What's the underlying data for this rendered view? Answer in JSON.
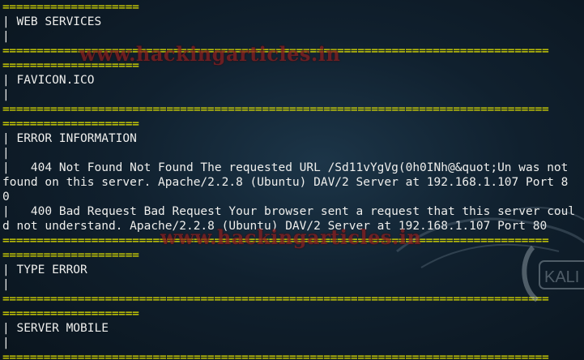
{
  "terminal": {
    "lines": [
      {
        "kind": "sep",
        "text": "===================="
      },
      {
        "kind": "text",
        "text": "| WEB SERVICES"
      },
      {
        "kind": "text",
        "text": "|"
      },
      {
        "kind": "sep",
        "text": "================================================================================"
      },
      {
        "kind": "sep",
        "text": "===================="
      },
      {
        "kind": "text",
        "text": "| FAVICON.ICO"
      },
      {
        "kind": "text",
        "text": "|"
      },
      {
        "kind": "sep",
        "text": "================================================================================"
      },
      {
        "kind": "sep",
        "text": "===================="
      },
      {
        "kind": "text",
        "text": "| ERROR INFORMATION"
      },
      {
        "kind": "text",
        "text": "|"
      },
      {
        "kind": "text",
        "text": "|   404 Not Found Not Found The requested URL /Sd11vYgVg(0h0INh@&quot;Un was not"
      },
      {
        "kind": "text",
        "text": "found on this server. Apache/2.2.8 (Ubuntu) DAV/2 Server at 192.168.1.107 Port 8"
      },
      {
        "kind": "text",
        "text": "0"
      },
      {
        "kind": "text",
        "text": "|   400 Bad Request Bad Request Your browser sent a request that this server coul"
      },
      {
        "kind": "text",
        "text": "d not understand. Apache/2.2.8 (Ubuntu) DAV/2 Server at 192.168.1.107 Port 80"
      },
      {
        "kind": "sep",
        "text": "================================================================================"
      },
      {
        "kind": "sep",
        "text": "===================="
      },
      {
        "kind": "text",
        "text": "| TYPE ERROR"
      },
      {
        "kind": "text",
        "text": "|"
      },
      {
        "kind": "sep",
        "text": "================================================================================"
      },
      {
        "kind": "sep",
        "text": "===================="
      },
      {
        "kind": "text",
        "text": "| SERVER MOBILE"
      },
      {
        "kind": "text",
        "text": "|"
      },
      {
        "kind": "sep",
        "text": "================================================================================"
      }
    ]
  },
  "watermarks": [
    "www.hackingarticles.in",
    "www.hackingarticles.in"
  ],
  "logo": {
    "text": "KALI"
  },
  "colors": {
    "separator": "#e6e600",
    "text": "#eeeeec",
    "watermark": "#8b1e1e"
  }
}
